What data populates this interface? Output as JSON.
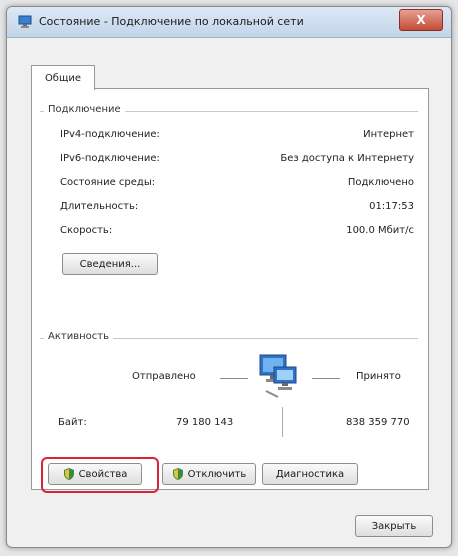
{
  "window": {
    "title": "Состояние - Подключение по локальной сети",
    "close_label": "X"
  },
  "tabs": [
    {
      "label": "Общие"
    }
  ],
  "connection": {
    "group_label": "Подключение",
    "rows": [
      {
        "label": "IPv4-подключение:",
        "value": "Интернет"
      },
      {
        "label": "IPv6-подключение:",
        "value": "Без доступа к Интернету"
      },
      {
        "label": "Состояние среды:",
        "value": "Подключено"
      },
      {
        "label": "Длительность:",
        "value": "01:17:53"
      },
      {
        "label": "Скорость:",
        "value": "100.0 Мбит/с"
      }
    ],
    "details_button": "Сведения..."
  },
  "activity": {
    "group_label": "Активность",
    "sent_label": "Отправлено",
    "received_label": "Принято",
    "bytes_label": "Байт:",
    "bytes_sent": "79 180 143",
    "bytes_received": "838 359 770"
  },
  "actions": {
    "properties": "Свойства",
    "disable": "Отключить",
    "diagnose": "Диагностика"
  },
  "footer": {
    "close_button": "Закрыть"
  }
}
